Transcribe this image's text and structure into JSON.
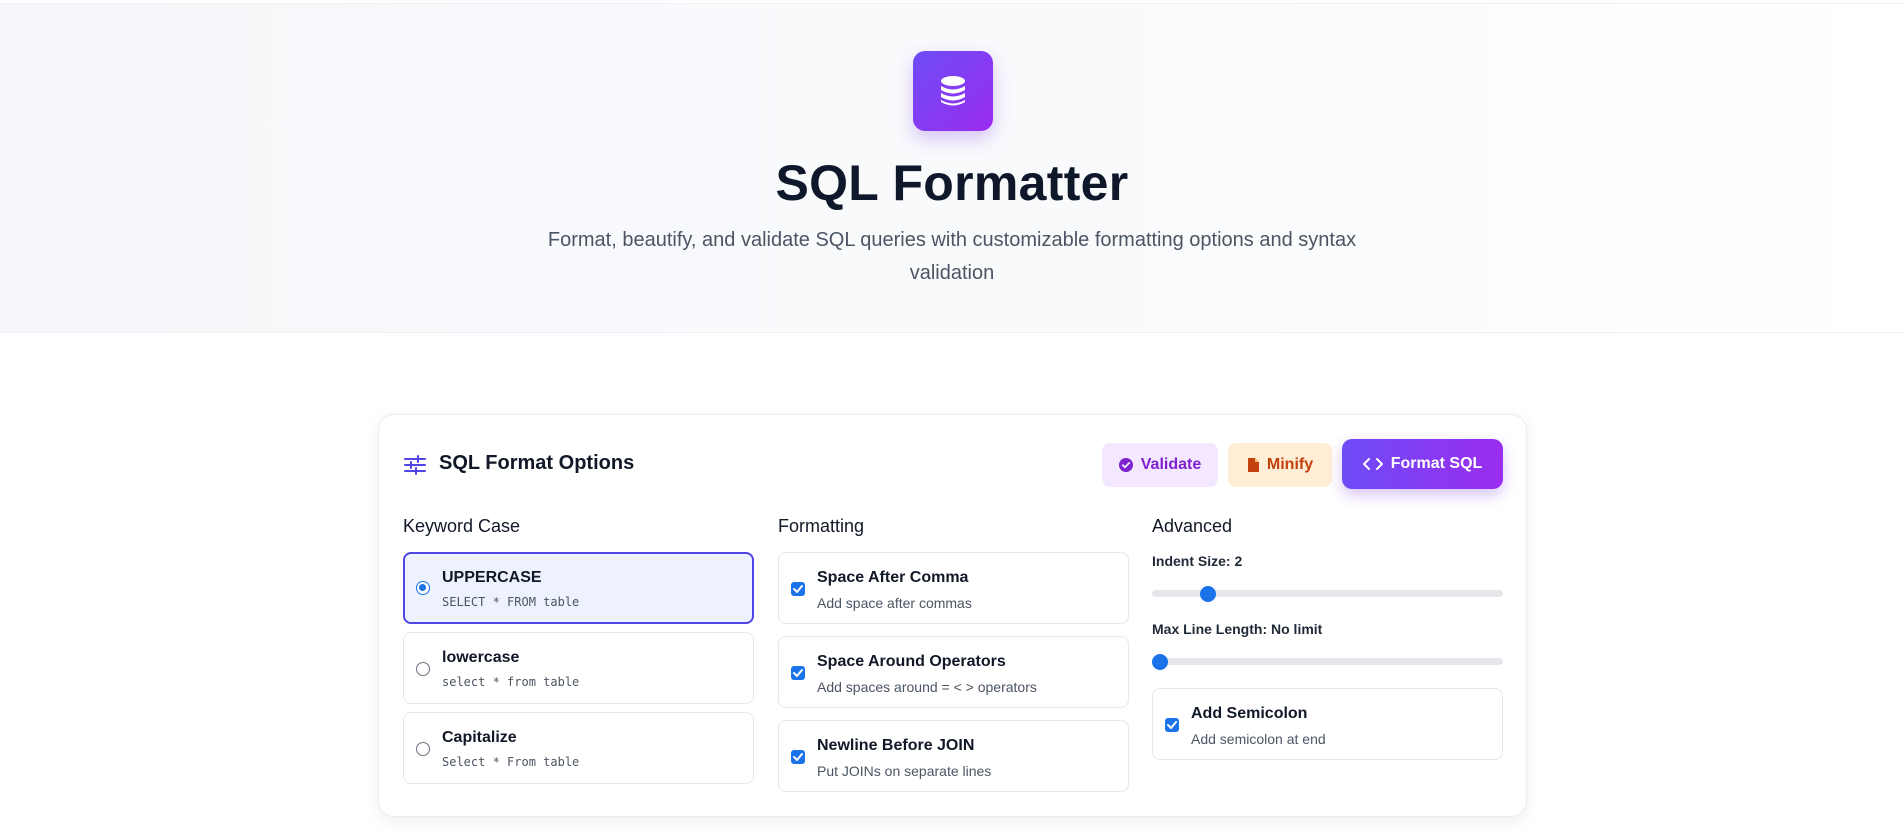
{
  "hero": {
    "title": "SQL Formatter",
    "subtitle": "Format, beautify, and validate SQL queries with customizable formatting options and syntax validation",
    "logo_icon": "database-icon"
  },
  "options_panel": {
    "title": "SQL Format Options",
    "title_icon": "sliders-icon",
    "buttons": {
      "validate": {
        "label": "Validate",
        "icon": "check-circle-icon"
      },
      "minify": {
        "label": "Minify",
        "icon": "file-icon"
      },
      "format": {
        "label": "Format SQL",
        "icon": "code-icon"
      }
    },
    "keyword_case": {
      "title": "Keyword Case",
      "selected": "UPPERCASE",
      "options": [
        {
          "label": "UPPERCASE",
          "example": "SELECT * FROM table"
        },
        {
          "label": "lowercase",
          "example": "select * from table"
        },
        {
          "label": "Capitalize",
          "example": "Select * From table"
        }
      ]
    },
    "formatting": {
      "title": "Formatting",
      "options": [
        {
          "label": "Space After Comma",
          "description": "Add space after commas",
          "checked": true
        },
        {
          "label": "Space Around Operators",
          "description": "Add spaces around = < > operators",
          "checked": true
        },
        {
          "label": "Newline Before JOIN",
          "description": "Put JOINs on separate lines",
          "checked": true
        }
      ]
    },
    "advanced": {
      "title": "Advanced",
      "indent_size": {
        "label": "Indent Size: 2",
        "value": 2,
        "min": 1,
        "max": 8
      },
      "max_line_length": {
        "label": "Max Line Length: No limit",
        "value": 0,
        "min": 0,
        "max": 200
      },
      "add_semicolon": {
        "label": "Add Semicolon",
        "description": "Add semicolon at end",
        "checked": true
      }
    }
  },
  "colors": {
    "accent_start": "#6d4cf6",
    "accent_end": "#9b2cf0",
    "control_blue": "#1a73e8",
    "validate_bg": "#f3e8ff",
    "validate_text": "#7e22ce",
    "minify_bg": "#ffedd5",
    "minify_text": "#c2410c"
  }
}
